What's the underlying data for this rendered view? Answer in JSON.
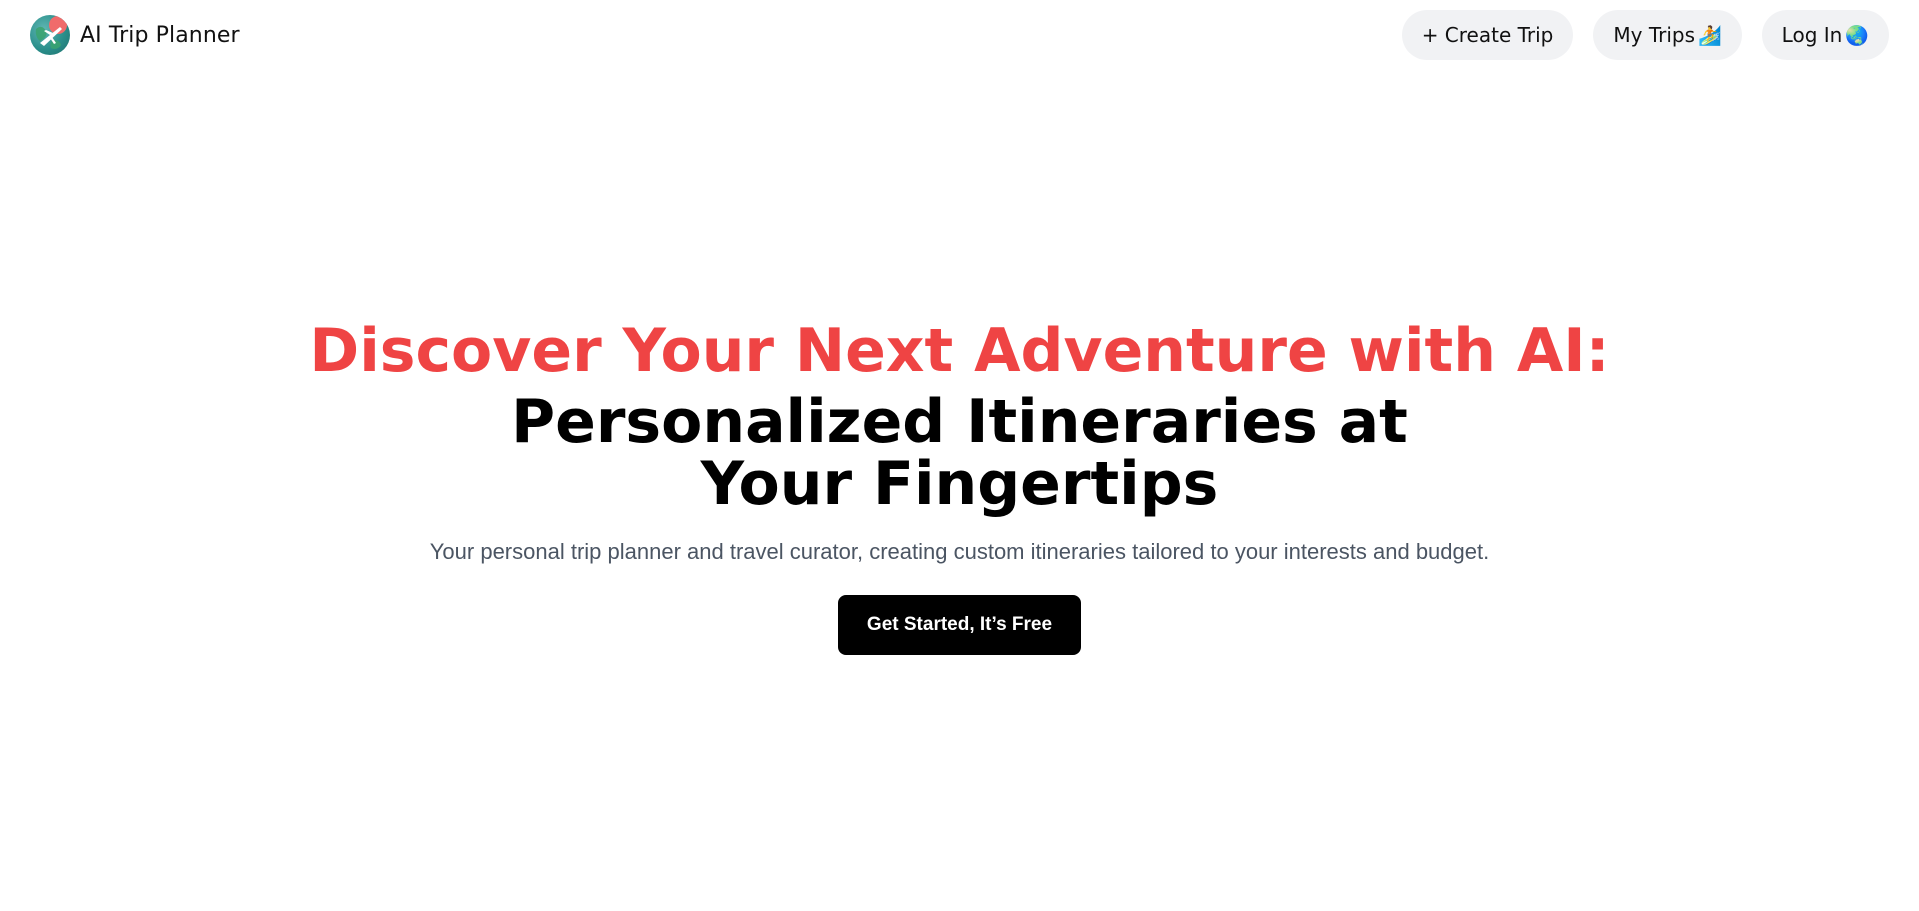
{
  "header": {
    "brand_name": "AI Trip Planner",
    "logo_icon": "globe-airplane-icon",
    "nav": {
      "create_trip": "+ Create Trip",
      "my_trips": "My Trips",
      "my_trips_emoji": "🏄",
      "login": "Log In",
      "login_emoji": "🌏"
    }
  },
  "hero": {
    "headline_line1": "Discover Your Next Adventure with AI:",
    "headline_line2": "Personalized Itineraries at Your Fingertips",
    "subtitle": "Your personal trip planner and travel curator, creating custom itineraries tailored to your interests and budget.",
    "cta_label": "Get Started, It’s Free"
  },
  "colors": {
    "accent_red": "#ef4444",
    "cta_background": "#000000",
    "nav_button_background": "#f1f2f4",
    "subtitle_text": "#4b5563"
  }
}
